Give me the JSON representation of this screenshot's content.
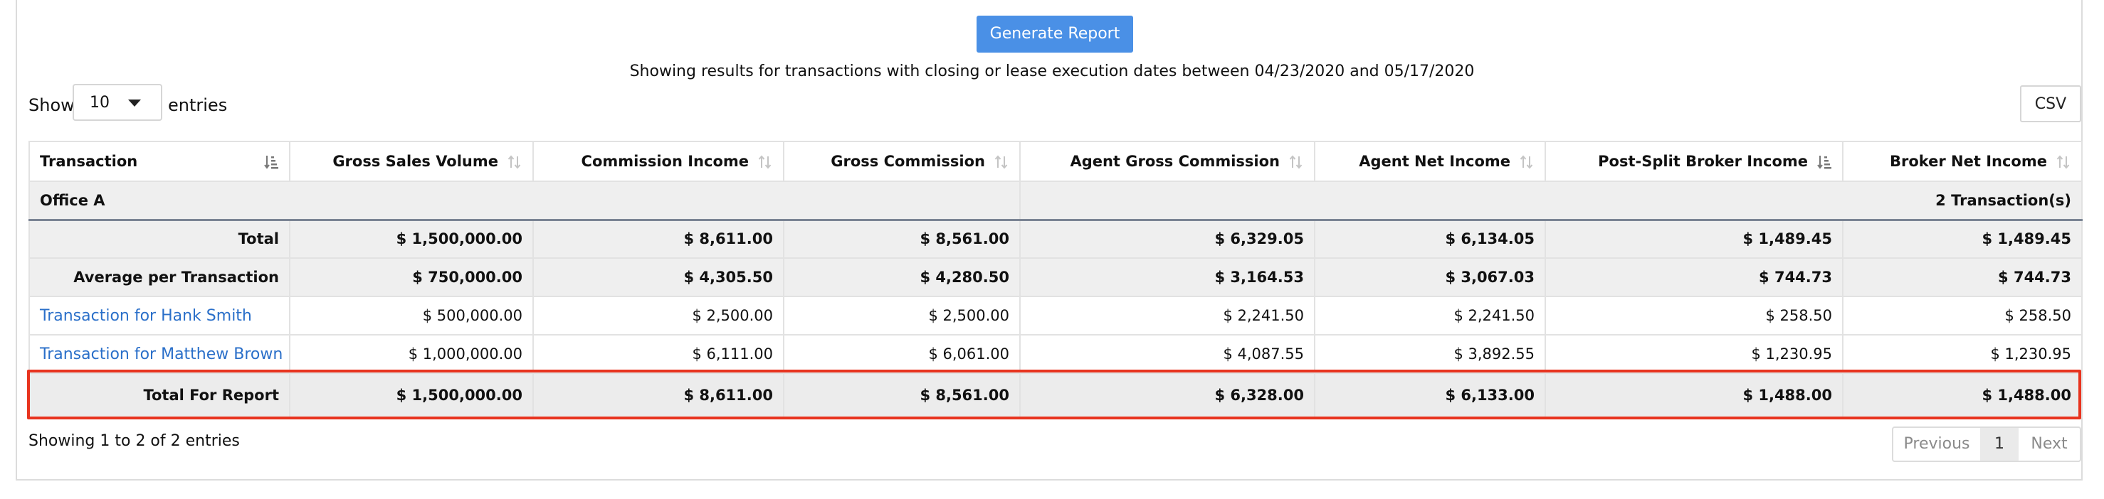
{
  "toolbar": {
    "generate_label": "Generate Report",
    "csv_label": "CSV"
  },
  "filter_text": "Showing results for transactions with closing or lease execution dates between 04/23/2020 and 05/17/2020",
  "length_control": {
    "show_label": "Show",
    "selected": "10",
    "entries_label": "entries"
  },
  "table": {
    "columns": [
      "Transaction",
      "Gross Sales Volume",
      "Commission Income",
      "Gross Commission",
      "Agent Gross Commission",
      "Agent Net Income",
      "Post-Split Broker Income",
      "Broker Net Income"
    ],
    "office_group": {
      "name": "Office A",
      "count": "2 Transaction(s)"
    },
    "total_row": [
      "Total",
      "$ 1,500,000.00",
      "$ 8,611.00",
      "$ 8,561.00",
      "$ 6,329.05",
      "$ 6,134.05",
      "$ 1,489.45",
      "$ 1,489.45"
    ],
    "average_row": [
      "Average per Transaction",
      "$ 750,000.00",
      "$ 4,305.50",
      "$ 4,280.50",
      "$ 3,164.53",
      "$ 3,067.03",
      "$ 744.73",
      "$ 744.73"
    ],
    "rows": [
      [
        "Transaction for Hank Smith",
        "$ 500,000.00",
        "$ 2,500.00",
        "$ 2,500.00",
        "$ 2,241.50",
        "$ 2,241.50",
        "$ 258.50",
        "$ 258.50"
      ],
      [
        "Transaction for Matthew Brown",
        "$ 1,000,000.00",
        "$ 6,111.00",
        "$ 6,061.00",
        "$ 4,087.55",
        "$ 3,892.55",
        "$ 1,230.95",
        "$ 1,230.95"
      ]
    ],
    "report_total_row": [
      "Total For Report",
      "$ 1,500,000.00",
      "$ 8,611.00",
      "$ 8,561.00",
      "$ 6,328.00",
      "$ 6,133.00",
      "$ 1,488.00",
      "$ 1,488.00"
    ]
  },
  "footer": {
    "info": "Showing 1 to 2 of 2 entries",
    "previous_label": "Previous",
    "current_page": "1",
    "next_label": "Next"
  },
  "colors": {
    "primary_button": "#4a90e6",
    "link": "#2a6fc9",
    "highlight_border": "#e8341f",
    "summary_background": "#efefef"
  },
  "icons": {
    "sort_active": "sort-amount-icon",
    "sort_inactive": "sort-arrows-icon"
  }
}
